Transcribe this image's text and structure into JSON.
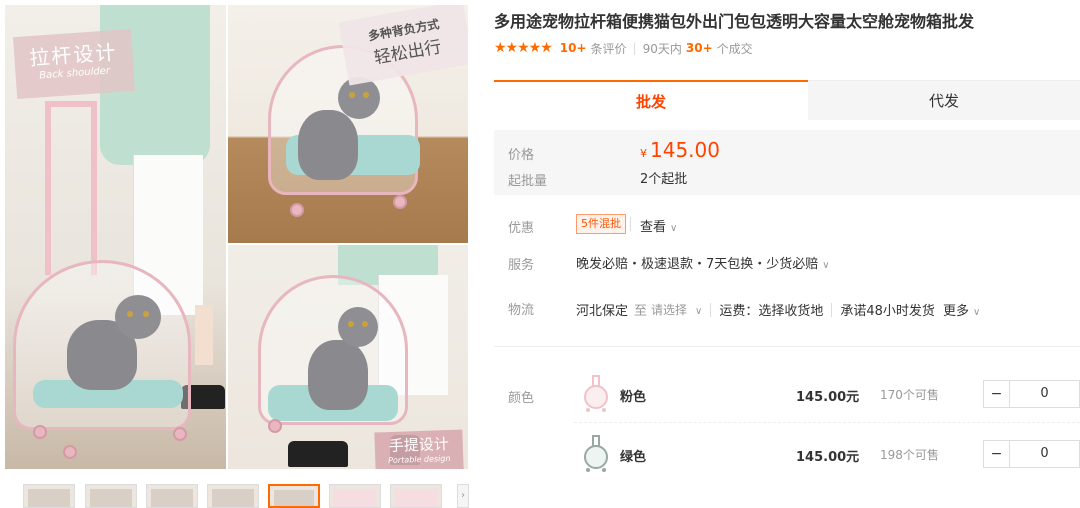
{
  "gallery": {
    "tag_a": {
      "big": "拉杆设计",
      "small": "Back shoulder"
    },
    "tag_b": {
      "line1": "多种背负方式",
      "line2": "轻松出行"
    },
    "tag_c": {
      "big": "手提设计",
      "small": "Portable design"
    }
  },
  "product": {
    "title": "多用途宠物拉杆箱便携猫包外出门包包透明大容量太空舱宠物箱批发",
    "stars": "★★★★★",
    "review_count": "10+",
    "review_label": "条评价",
    "sales_period": "90天内",
    "sales_count": "30+",
    "sales_label": "个成交"
  },
  "tabs": {
    "wholesale": "批发",
    "dropship": "代发"
  },
  "price_box": {
    "price_label": "价格",
    "currency": "¥",
    "price": "145.00",
    "moq_label": "起批量",
    "moq_value": "2个起批"
  },
  "promo": {
    "label": "优惠",
    "tag": "5件混批",
    "view": "查看"
  },
  "service": {
    "label": "服务",
    "text": "晚发必赔・极速退款・7天包换・少货必赔"
  },
  "logistics": {
    "label": "物流",
    "origin": "河北保定",
    "to": "至",
    "select": "请选择",
    "freight": "运费：选择收货地",
    "promise": "承诺48小时发货",
    "more": "更多"
  },
  "sku": {
    "label": "颜色",
    "items": [
      {
        "name": "粉色",
        "price": "145.00元",
        "stock": "170个可售",
        "qty": "0",
        "color": "#f0c3cb"
      },
      {
        "name": "绿色",
        "price": "145.00元",
        "stock": "198个可售",
        "qty": "0",
        "color": "#bfd6cf"
      }
    ]
  },
  "icons": {
    "chevron": "chevron-down-icon",
    "minus": "minus-icon"
  }
}
